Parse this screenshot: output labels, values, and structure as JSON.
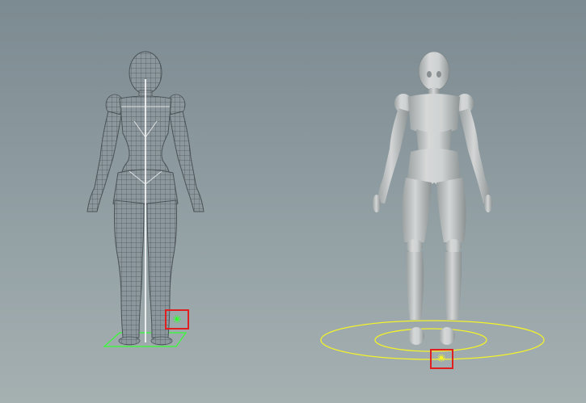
{
  "viewport": {
    "background_top": "#7c8a91",
    "background_bottom": "#a5b0b1"
  },
  "wireframe_figure": {
    "display": "wireframe",
    "line_color": "#5a6268",
    "spine_color": "#ffffff",
    "ground_plane_color": "#33ff33",
    "handle_color": "#33ff33",
    "handle_icon": "gear-icon",
    "selection_box_color": "#e02020"
  },
  "shaded_figure": {
    "display": "shaded",
    "surface_color": "#c9cccc",
    "shadow_color": "#8f9596",
    "orbit_ring_color": "#f3f32a",
    "handle_color": "#f3f32a",
    "handle_icon": "gear-icon",
    "selection_box_color": "#e02020"
  }
}
